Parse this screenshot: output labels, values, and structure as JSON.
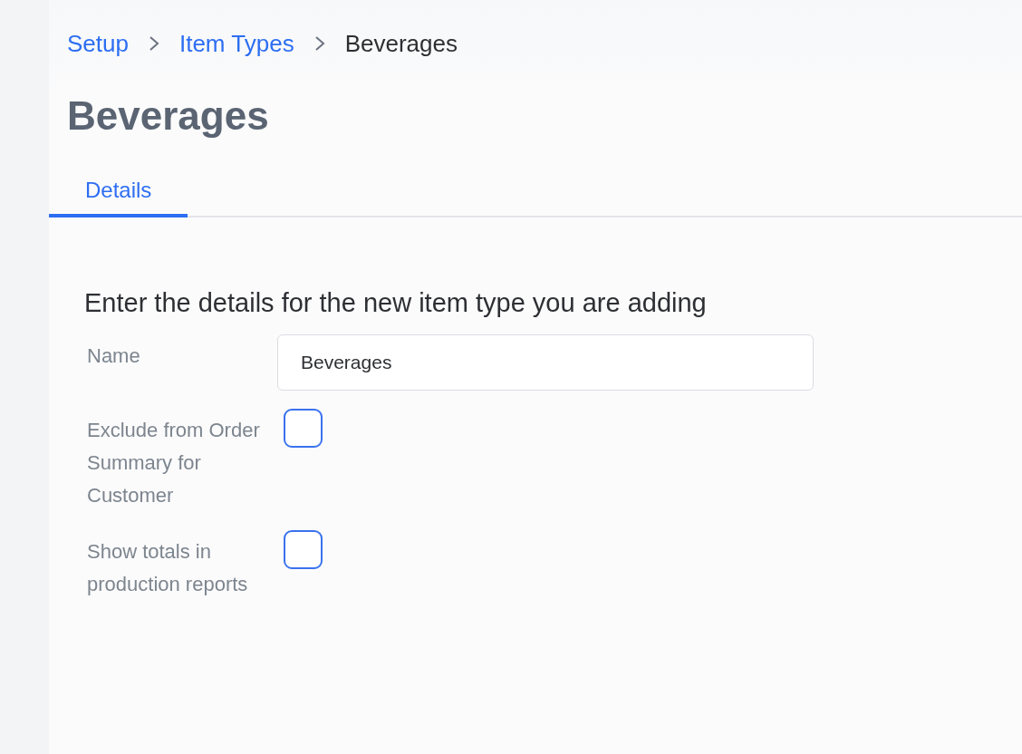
{
  "breadcrumb": [
    {
      "label": "Setup",
      "kind": "link"
    },
    {
      "label": "Item Types",
      "kind": "link"
    },
    {
      "label": "Beverages",
      "kind": "current"
    }
  ],
  "page_title": "Beverages",
  "tabs": [
    {
      "label": "Details",
      "selected": true
    }
  ],
  "form": {
    "heading": "Enter the details for the new item type you are adding",
    "fields": [
      {
        "kind": "text",
        "label": "Name",
        "value": "Beverages"
      },
      {
        "kind": "checkbox",
        "label": "Exclude from Order Summary for Customer",
        "checked": false
      },
      {
        "kind": "checkbox",
        "label": "Show totals in production reports",
        "checked": false
      }
    ]
  }
}
